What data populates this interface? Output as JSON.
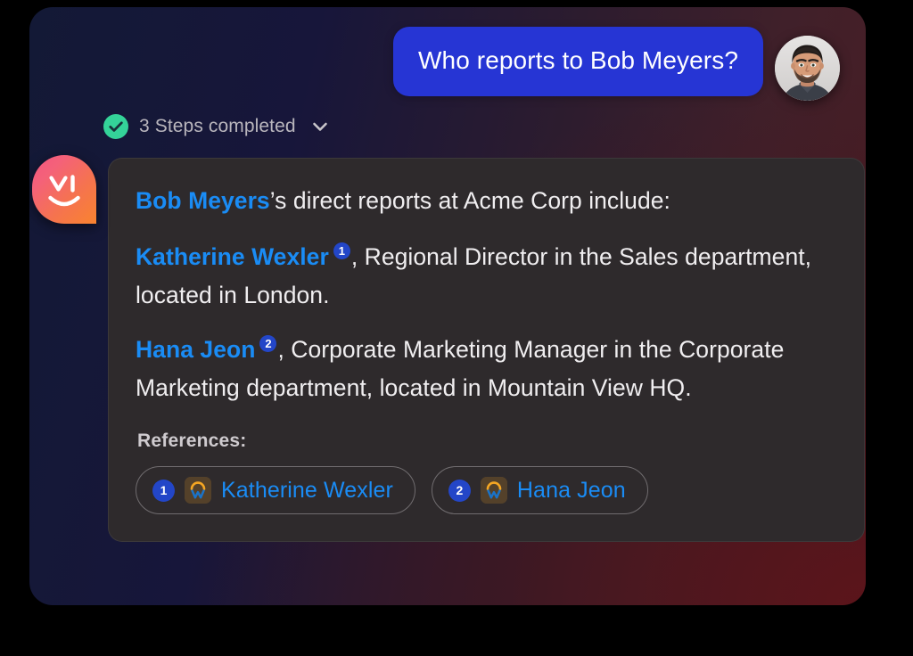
{
  "window": {
    "name": "ai-assistant-chat-window"
  },
  "conversation": {
    "user_message": {
      "text": "Who reports to Bob Meyers?",
      "avatar_alt": "user-avatar"
    },
    "steps": {
      "label": "3 Steps completed",
      "status_icon": "check-circle-icon",
      "expand_icon": "chevron-down-icon",
      "expanded": false
    },
    "answer": {
      "paragraphs": [
        {
          "id": "intro",
          "entity": "Bob Meyers",
          "rest": "’s direct reports at Acme Corp include:"
        },
        {
          "id": "report-1",
          "entity": "Katherine Wexler",
          "citation": "1",
          "rest": ", Regional Director in the Sales department, located in London."
        },
        {
          "id": "report-2",
          "entity": "Hana Jeon",
          "citation": "2",
          "rest": ", Corporate Marketing Manager in the Corporate Marketing department, located in Mountain View HQ."
        }
      ],
      "references_label": "References:",
      "references": [
        {
          "number": "1",
          "source_icon": "workday-icon",
          "label": "Katherine Wexler"
        },
        {
          "number": "2",
          "source_icon": "workday-icon",
          "label": "Hana Jeon"
        }
      ]
    }
  },
  "branding": {
    "assistant_badge_icon": "ai-face-logo-icon"
  },
  "colors": {
    "user_bubble": "#2635d4",
    "entity_link": "#1a8cf5",
    "citation_badge": "#2346c8",
    "answer_card": "#2e2a2c",
    "status_check": "#34d399",
    "workday_arc": "#f5a623",
    "workday_w": "#1a73c8",
    "badge_gradient_start": "#f4557f",
    "badge_gradient_end": "#f9832f"
  }
}
